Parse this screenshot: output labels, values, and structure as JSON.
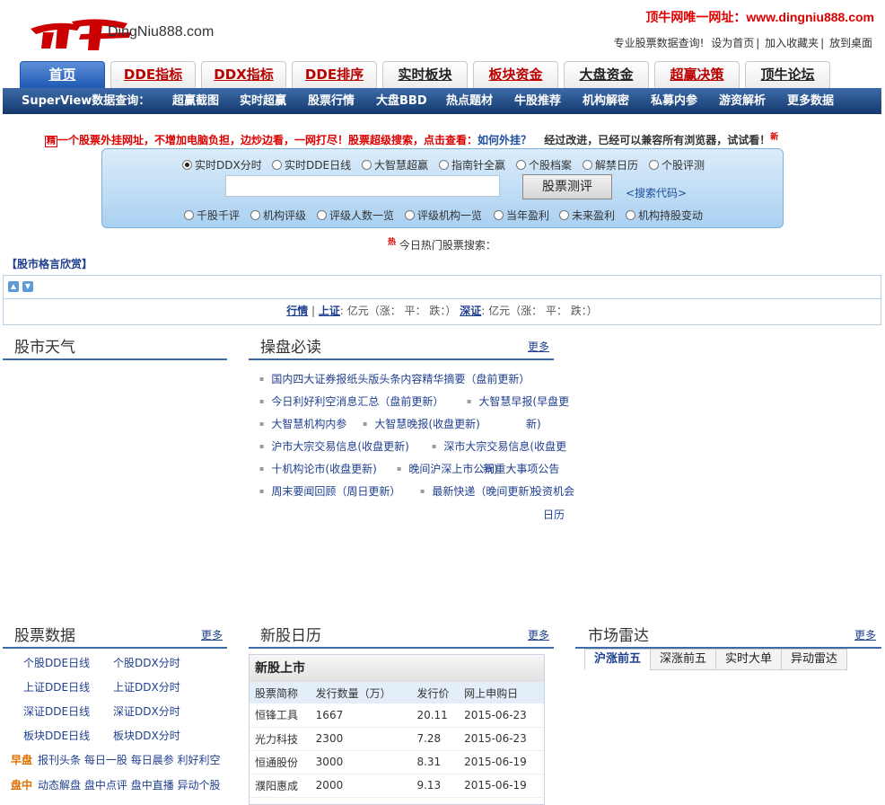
{
  "header": {
    "logo_text": "DingNiu888.com",
    "site_url": "顶牛网唯一网址：www.dingniu888.com",
    "links": [
      "专业股票数据查询!",
      "设为首页",
      "加入收藏夹",
      "放到桌面"
    ]
  },
  "nav_tabs": [
    {
      "label": "首页",
      "active": true
    },
    {
      "label": "DDE指标"
    },
    {
      "label": "DDX指标"
    },
    {
      "label": "DDE排序"
    },
    {
      "label": "实时板块",
      "dark": true
    },
    {
      "label": "板块资金"
    },
    {
      "label": "大盘资金",
      "dark": true
    },
    {
      "label": "超赢决策"
    },
    {
      "label": "顶牛论坛",
      "dark": true
    }
  ],
  "bluebar": {
    "label": "SuperView数据查询：",
    "items": [
      "超赢截图",
      "实时超赢",
      "股票行情",
      "大盘BBD",
      "热点题材",
      "牛股推荐",
      "机构解密",
      "私募内参",
      "游资解析",
      "更多数据"
    ]
  },
  "notice": {
    "badge": "精",
    "text": "一个股票外挂网址，不增加电脑负担，边炒边看，一网打尽！股票超级搜索，点击查看：",
    "link": "如何外挂？",
    "tail": "经过改进，已经可以兼容所有浏览器，试试看！",
    "new": "新"
  },
  "search": {
    "row1": [
      "实时DDX分时",
      "实时DDE日线",
      "大智慧超赢",
      "指南针全赢",
      "个股档案",
      "解禁日历",
      "个股评测"
    ],
    "row2": [
      "千股千评",
      "机构评级",
      "评级人数一览",
      "评级机构一览",
      "当年盈利",
      "未来盈利",
      "机构持股变动"
    ],
    "button": "股票测评",
    "code_link": "<搜索代码>"
  },
  "hot": {
    "badge": "热",
    "label": "今日热门股票搜索："
  },
  "motto": "【股市格言欣赏】",
  "quote": {
    "hq": "行情",
    "sh": "上证",
    "sh_val": "亿元（涨：  平：  跌：）",
    "sz": "深证",
    "sz_val": "亿元（涨：  平：  跌：）"
  },
  "sections": {
    "weather": "股市天气",
    "must_read": "操盘必读",
    "stock_data": "股票数据",
    "ipo": "新股日历",
    "radar": "市场雷达",
    "more": "更多"
  },
  "articles_col1": [
    "国内四大证券报纸头版头条内容精华摘要（盘前更新）",
    "今日利好利空消息汇总（盘前更新）",
    "大智慧机构内参",
    "沪市大宗交易信息(收盘更新)",
    "十机构论市(收盘更新)",
    "周末要闻回顾（周日更新）"
  ],
  "articles_col2": [
    "大智慧早报(早盘更",
    "新)",
    "大智慧晚报(收盘更新)",
    "深市大宗交易信息(收盘更",
    "新)",
    "晚间沪深上市公司重大事项公告",
    "最新快递（晚间更新）",
    "投资机会",
    "日历"
  ],
  "stock_data_links": [
    "个股DDE日线",
    "个股DDX分时",
    "上证DDE日线",
    "上证DDX分时",
    "深证DDE日线",
    "深证DDX分时",
    "板块DDE日线",
    "板块DDX分时"
  ],
  "categories": [
    {
      "tag": "早盘",
      "items": [
        "报刊头条",
        "每日一股",
        "每日晨参",
        "利好利空"
      ]
    },
    {
      "tag": "盘中",
      "items": [
        "动态解盘",
        "盘中点评",
        "盘中直播",
        "异动个股"
      ]
    }
  ],
  "ipo": {
    "title": "新股上市",
    "headers": [
      "股票简称",
      "发行数量（万）",
      "发行价",
      "网上申购日"
    ],
    "rows": [
      [
        "恒锋工具",
        "1667",
        "20.11",
        "2015-06-23"
      ],
      [
        "光力科技",
        "2300",
        "7.28",
        "2015-06-23"
      ],
      [
        "恒通股份",
        "3000",
        "8.31",
        "2015-06-19"
      ],
      [
        "濮阳惠成",
        "2000",
        "9.13",
        "2015-06-19"
      ]
    ]
  },
  "radar_tabs": [
    "沪涨前五",
    "深涨前五",
    "实时大单",
    "异动雷达"
  ]
}
